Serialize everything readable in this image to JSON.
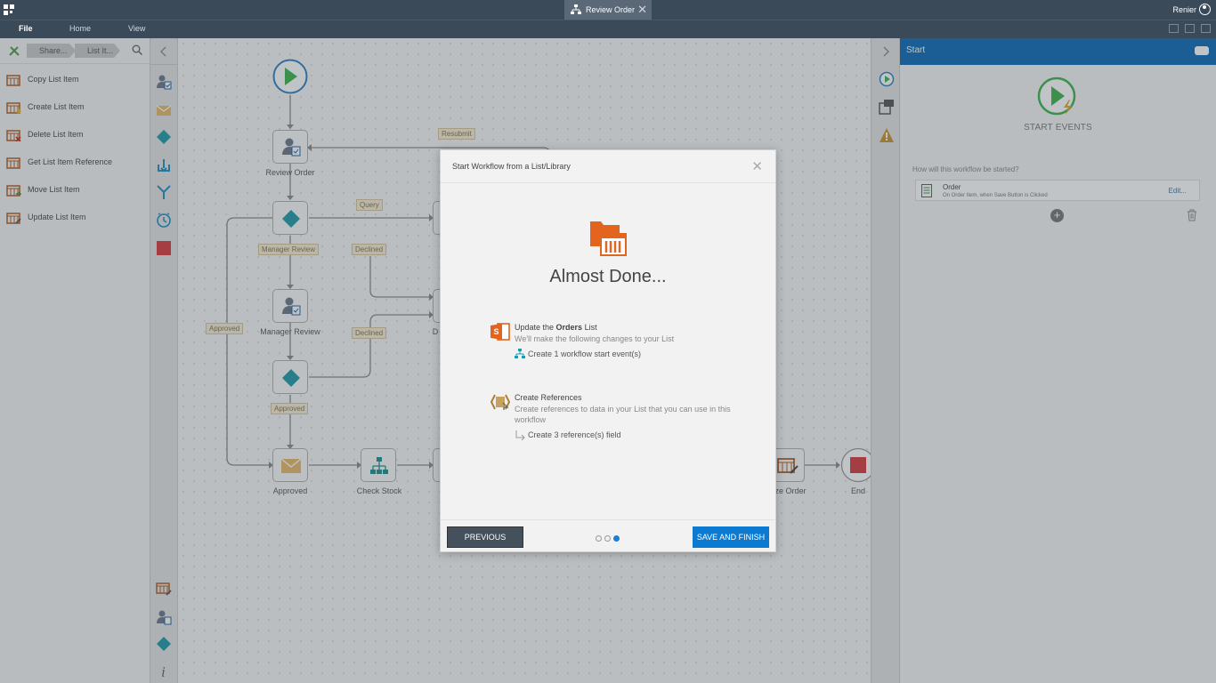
{
  "titlebar": {
    "tab_title": "Review Order",
    "user_name": "Renier"
  },
  "ribbon": {
    "tabs": [
      "File",
      "Home",
      "View"
    ]
  },
  "left_panel": {
    "breadcrumbs": [
      "Share...",
      "List It..."
    ],
    "actions": [
      "Copy List Item",
      "Create List Item",
      "Delete List Item",
      "Get List Item Reference",
      "Move List Item",
      "Update List Item"
    ]
  },
  "workflow": {
    "nodes": {
      "review_order": "Review Order",
      "manager_review": "Manager Review",
      "approved": "Approved",
      "check_stock": "Check Stock",
      "finalize_order": "lize Order",
      "end": "End",
      "partial_d": "D"
    },
    "connectors": {
      "resubmit": "Resubmit",
      "query": "Query",
      "manager_review": "Manager Review",
      "declined_1": "Declined",
      "declined_2": "Declined",
      "approved_left": "Approved",
      "approved_mid": "Approved"
    }
  },
  "right_panel": {
    "header": "Start",
    "section_title": "START EVENTS",
    "question": "How will this workflow be started?",
    "event": {
      "title": "Order",
      "subtitle": "On Order Item, when Save Button is Clicked",
      "edit_label": "Edit..."
    }
  },
  "modal": {
    "title": "Start Workflow from a List/Library",
    "heading": "Almost Done...",
    "step1": {
      "title_prefix": "Update the ",
      "title_bold": "Orders",
      "title_suffix": " List",
      "description": "We'll make the following changes to your List",
      "sub": "Create 1 workflow start event(s)"
    },
    "step2": {
      "title": "Create References",
      "description": "Create references to data in your List that you can use in this workflow",
      "sub": "Create 3 reference(s) field"
    },
    "buttons": {
      "previous": "PREVIOUS",
      "save_finish": "SAVE AND FINISH"
    },
    "current_step": 3,
    "total_steps": 3
  },
  "colors": {
    "titlebar": "#3b4a59",
    "accent_blue": "#0b7ad0",
    "orange": "#e2641e",
    "teal": "#1e9aa8",
    "green": "#3db34a"
  }
}
